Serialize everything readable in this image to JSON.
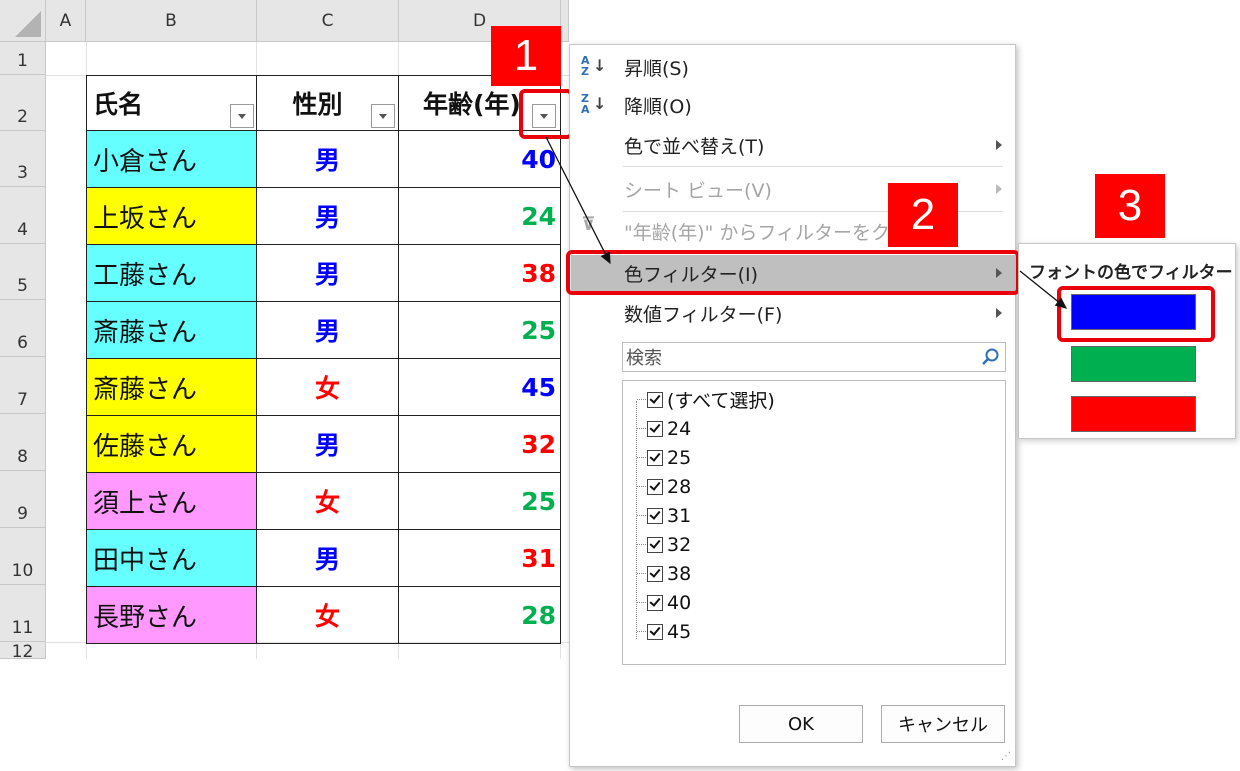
{
  "sheet": {
    "columns": [
      "A",
      "B",
      "C",
      "D"
    ],
    "rows": [
      "1",
      "2",
      "3",
      "4",
      "5",
      "6",
      "7",
      "8",
      "9",
      "10",
      "11",
      "12"
    ],
    "headers": {
      "name": "氏名",
      "gender": "性別",
      "age": "年齢(年)"
    },
    "data": [
      {
        "name": "小倉さん",
        "gender": "男",
        "age": "40",
        "name_bg": "#66ffff",
        "gender_color": "#0000ff",
        "age_color": "#0000ff"
      },
      {
        "name": "上坂さん",
        "gender": "男",
        "age": "24",
        "name_bg": "#ffff00",
        "gender_color": "#0000ff",
        "age_color": "#00b050"
      },
      {
        "name": "工藤さん",
        "gender": "男",
        "age": "38",
        "name_bg": "#66ffff",
        "gender_color": "#0000ff",
        "age_color": "#ff0000"
      },
      {
        "name": "斎藤さん",
        "gender": "男",
        "age": "25",
        "name_bg": "#66ffff",
        "gender_color": "#0000ff",
        "age_color": "#00b050"
      },
      {
        "name": "斎藤さん",
        "gender": "女",
        "age": "45",
        "name_bg": "#ffff00",
        "gender_color": "#ff0000",
        "age_color": "#0000ff"
      },
      {
        "name": "佐藤さん",
        "gender": "男",
        "age": "32",
        "name_bg": "#ffff00",
        "gender_color": "#0000ff",
        "age_color": "#ff0000"
      },
      {
        "name": "須上さん",
        "gender": "女",
        "age": "25",
        "name_bg": "#ff99ff",
        "gender_color": "#ff0000",
        "age_color": "#00b050"
      },
      {
        "name": "田中さん",
        "gender": "男",
        "age": "31",
        "name_bg": "#66ffff",
        "gender_color": "#0000ff",
        "age_color": "#ff0000"
      },
      {
        "name": "長野さん",
        "gender": "女",
        "age": "28",
        "name_bg": "#ff99ff",
        "gender_color": "#ff0000",
        "age_color": "#00b050"
      }
    ]
  },
  "callouts": {
    "one": "1",
    "two": "2",
    "three": "3"
  },
  "menu": {
    "sort_asc": "昇順(S)",
    "sort_desc": "降順(O)",
    "sort_by_color": "色で並べ替え(T)",
    "sheet_view": "シート ビュー(V)",
    "clear_filter": "\"年齢(年)\" からフィルターをクリア(C)",
    "color_filter": "色フィルター(I)",
    "number_filter": "数値フィルター(F)",
    "search_placeholder": "検索",
    "list_items": [
      "(すべて選択)",
      "24",
      "25",
      "28",
      "31",
      "32",
      "38",
      "40",
      "45"
    ],
    "ok": "OK",
    "cancel": "キャンセル"
  },
  "submenu": {
    "title": "フォントの色でフィルター",
    "colors": [
      "#0000ff",
      "#00b050",
      "#ff0000"
    ]
  },
  "icons": {
    "sort_asc": "sort-ascending-icon",
    "sort_desc": "sort-descending-icon",
    "clear": "clear-filter-icon",
    "search": "search-icon"
  }
}
